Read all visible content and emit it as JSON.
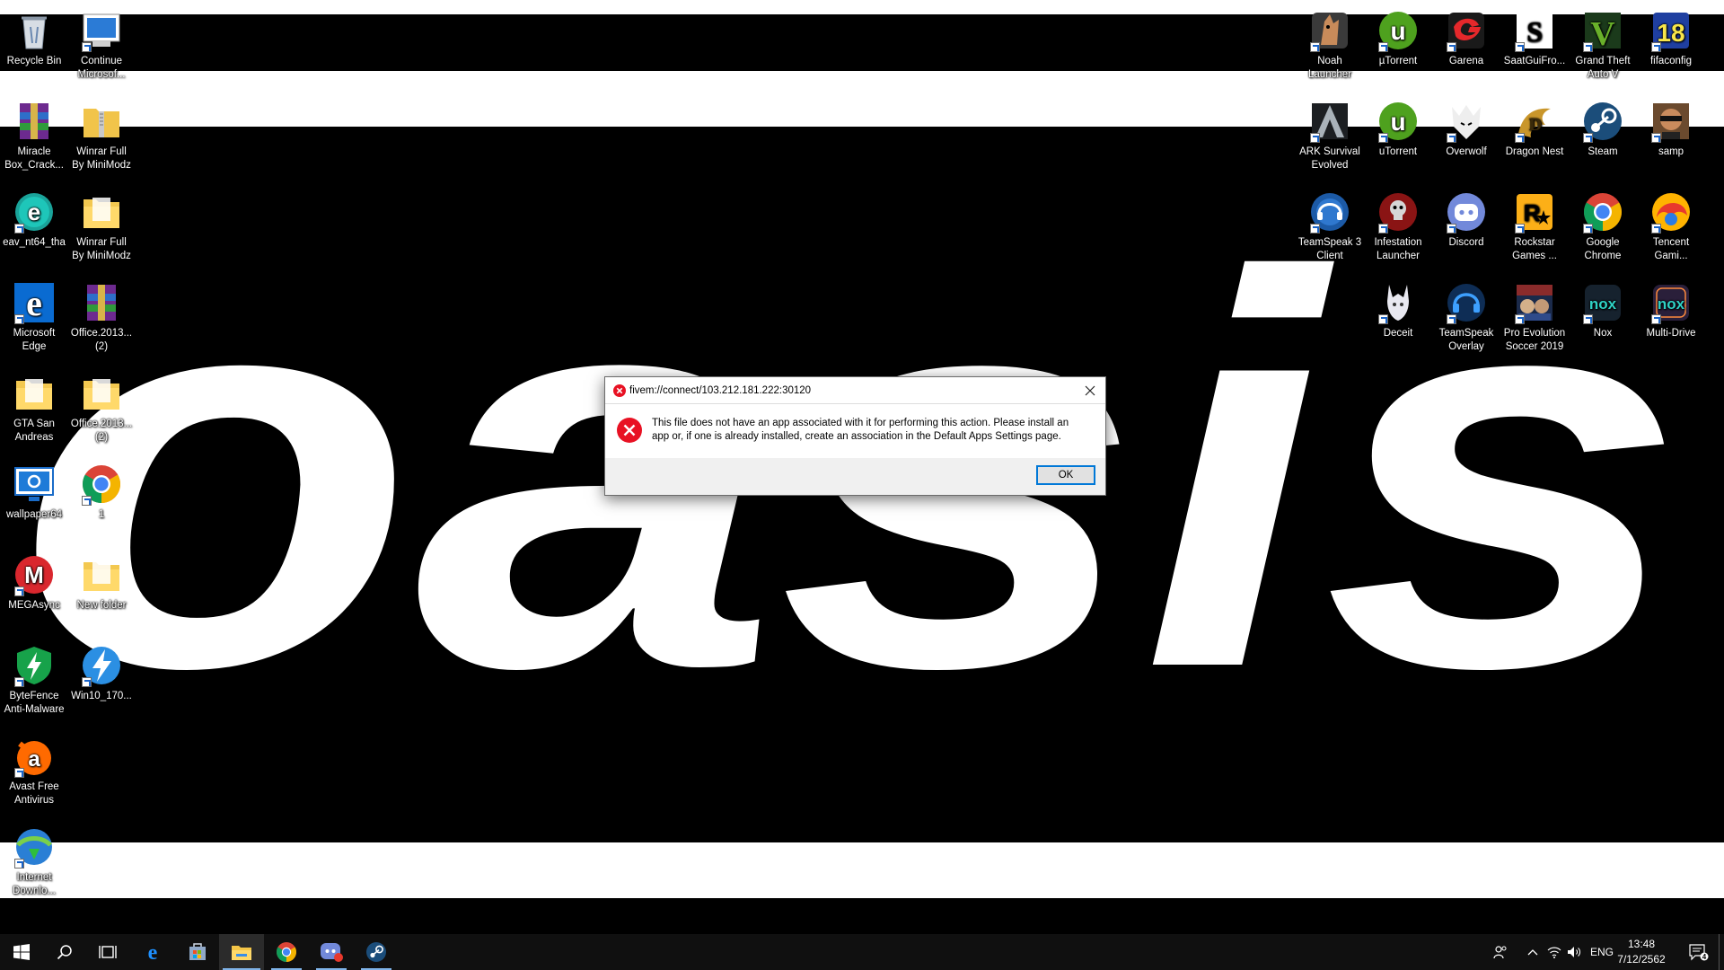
{
  "wallpaper": {
    "word": "oasis"
  },
  "desktop_left": [
    {
      "label": "Recycle Bin",
      "icon": "recycle-bin-icon"
    },
    {
      "label": "Continue\nMicrosof...",
      "icon": "continue-microsoft-icon"
    },
    {
      "label": "Miracle\nBox_Crack...",
      "icon": "winrar-archive-icon"
    },
    {
      "label": "Winrar Full\nBy MiniModz",
      "icon": "zip-folder-icon"
    },
    {
      "label": "eav_nt64_tha",
      "icon": "eset-icon"
    },
    {
      "label": "Winrar Full\nBy MiniModz",
      "icon": "folder-icon"
    },
    {
      "label": "Microsoft\nEdge",
      "icon": "edge-icon"
    },
    {
      "label": "Office.2013...\n(2)",
      "icon": "winrar-archive-icon"
    },
    {
      "label": "GTA San\nAndreas",
      "icon": "folder-icon"
    },
    {
      "label": "Office.2013...\n(2)",
      "icon": "folder-icon"
    },
    {
      "label": "wallpaper64",
      "icon": "wallpaper-app-icon"
    },
    {
      "label": "1",
      "icon": "chrome-icon"
    },
    {
      "label": "MEGAsync",
      "icon": "mega-icon"
    },
    {
      "label": "New folder",
      "icon": "folder-icon"
    },
    {
      "label": "ByteFence\nAnti-Malware",
      "icon": "bytefence-icon"
    },
    {
      "label": "Win10_170...",
      "icon": "daemon-tools-icon"
    },
    {
      "label": "Avast Free\nAntivirus",
      "icon": "avast-icon"
    },
    {
      "label": "Internet\nDownlo...",
      "icon": "idm-icon"
    }
  ],
  "desktop_right": [
    {
      "label": "Noah\nLauncher",
      "icon": "noah-launcher-icon"
    },
    {
      "label": "µTorrent",
      "icon": "utorrent-icon"
    },
    {
      "label": "Garena",
      "icon": "garena-icon"
    },
    {
      "label": "SaatGuiFro...",
      "icon": "saatgui-icon"
    },
    {
      "label": "Grand Theft\nAuto V",
      "icon": "gta5-icon"
    },
    {
      "label": "fifaconfig",
      "icon": "fifaconfig-icon"
    },
    {
      "label": "ARK Survival\nEvolved",
      "icon": "ark-icon"
    },
    {
      "label": "uTorrent",
      "icon": "utorrent-icon"
    },
    {
      "label": "Overwolf",
      "icon": "overwolf-icon"
    },
    {
      "label": "Dragon Nest",
      "icon": "dragon-nest-icon"
    },
    {
      "label": "Steam",
      "icon": "steam-icon"
    },
    {
      "label": "samp",
      "icon": "samp-icon"
    },
    {
      "label": "TeamSpeak 3\nClient",
      "icon": "teamspeak-icon"
    },
    {
      "label": "Infestation\nLauncher",
      "icon": "infestation-icon"
    },
    {
      "label": "Discord",
      "icon": "discord-icon"
    },
    {
      "label": "Rockstar\nGames ...",
      "icon": "rockstar-icon"
    },
    {
      "label": "Google\nChrome",
      "icon": "chrome-icon"
    },
    {
      "label": "Tencent\nGami...",
      "icon": "tencent-icon"
    },
    {
      "label": "Deceit",
      "icon": "deceit-icon"
    },
    {
      "label": "TeamSpeak\nOverlay",
      "icon": "teamspeak-overlay-icon"
    },
    {
      "label": "Pro Evolution\nSoccer 2019",
      "icon": "pes-icon"
    },
    {
      "label": "Nox",
      "icon": "nox-icon"
    },
    {
      "label": "Multi-Drive",
      "icon": "multi-drive-icon"
    }
  ],
  "dialog": {
    "title": "fivem://connect/103.212.181.222:30120",
    "message": "This file does not have an app associated with it for performing this action. Please install an app or, if one is already installed, create an association in the Default Apps Settings page.",
    "ok_label": "OK"
  },
  "taskbar": {
    "language": "ENG",
    "time": "13:48",
    "date": "7/12/2562",
    "notification_count": "4",
    "pinned": [
      "start-icon",
      "search-icon",
      "task-view-icon",
      "edge-icon",
      "store-icon",
      "file-explorer-icon",
      "chrome-icon",
      "discord-icon",
      "steam-icon"
    ]
  },
  "colors": {
    "accent": "#0078d7",
    "error_red": "#e81123"
  }
}
